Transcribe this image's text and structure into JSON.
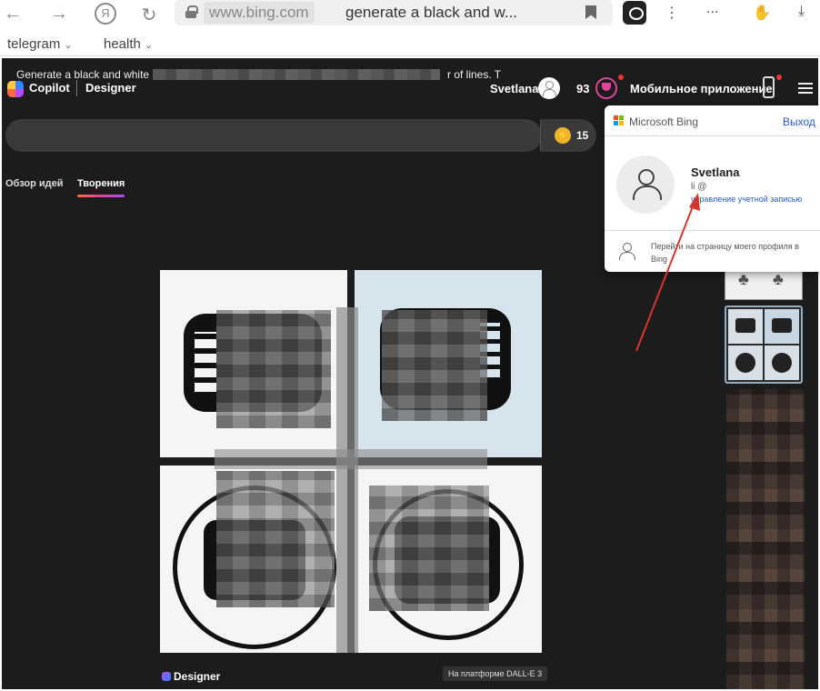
{
  "browser": {
    "address_domain": "www.bing.com",
    "address_query": "generate a black and w...",
    "more_label": "⋮",
    "extensions_label": "...",
    "bookmarks": [
      {
        "label": "telegram"
      },
      {
        "label": "health"
      }
    ]
  },
  "header": {
    "brand": "Copilot",
    "product": "Designer",
    "username": "Svetlana",
    "points": "93",
    "mobile_app": "Мобильное приложение"
  },
  "prompt": {
    "text": "Generate a black and white",
    "tail": "r of lines. T",
    "boosts": "15"
  },
  "tabs": [
    {
      "label": "Обзор идей"
    },
    {
      "label": "Творения"
    }
  ],
  "footer": {
    "designer_label": "Designer",
    "dalle_badge": "На платформе DALL-E 3"
  },
  "popup": {
    "provider": "Microsoft Bing",
    "logout": "Выход",
    "username": "Svetlana",
    "email": "li @",
    "manage": "управление учетной записью",
    "profile_link": "Перейти на страницу моего профиля в Bing"
  },
  "colors": {
    "app_bg": "#1c1c1c",
    "accent_pink": "#e0459a",
    "link_blue": "#2a5bd7",
    "arrow_red": "#d9342b"
  }
}
